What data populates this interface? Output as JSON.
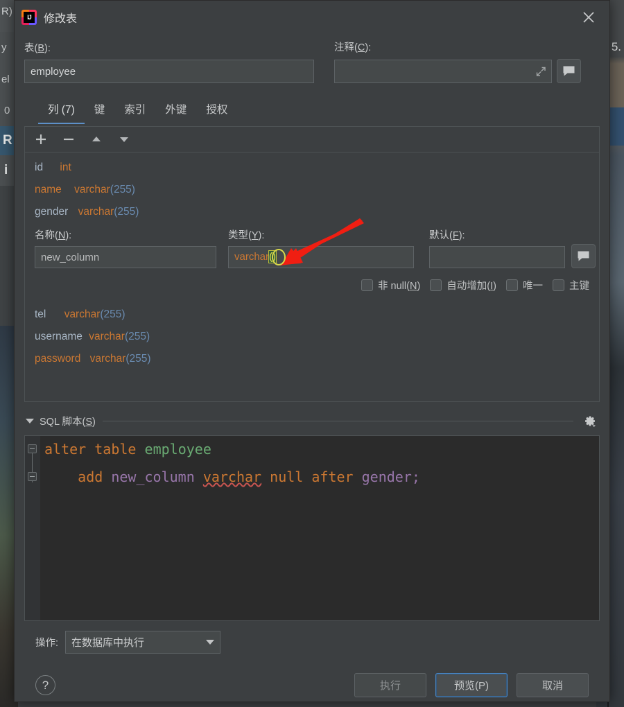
{
  "window": {
    "title": "修改表",
    "app_icon": "intellij-idea-logo",
    "close_icon": "close-icon"
  },
  "table_field": {
    "label": "表(B):",
    "label_plain": "表(",
    "mnemonic": "B",
    "label_suffix": "):",
    "value": "employee",
    "placeholder": ""
  },
  "comment_field": {
    "label_plain": "注释(",
    "mnemonic": "C",
    "label_suffix": "):",
    "value": "",
    "placeholder": "",
    "expand_icon": "expand-icon",
    "bubble_icon": "comment-bubble-icon"
  },
  "tabs": [
    {
      "label": "列 (7)",
      "active": true
    },
    {
      "label": "键",
      "active": false
    },
    {
      "label": "索引",
      "active": false
    },
    {
      "label": "外键",
      "active": false
    },
    {
      "label": "授权",
      "active": false
    }
  ],
  "columns_toolbar": [
    {
      "name": "add-column-button",
      "icon": "plus-icon"
    },
    {
      "name": "remove-column-button",
      "icon": "minus-icon"
    },
    {
      "name": "move-up-button",
      "icon": "arrow-up-icon"
    },
    {
      "name": "move-down-button",
      "icon": "arrow-down-icon"
    }
  ],
  "columns_before": [
    {
      "name": "id",
      "highlight": false,
      "type": "int",
      "length": ""
    },
    {
      "name": "name",
      "highlight": true,
      "type": "varchar",
      "length": "(255)"
    },
    {
      "name": "gender",
      "highlight": false,
      "type": "varchar",
      "length": "(255)"
    }
  ],
  "columns_after": [
    {
      "name": "tel",
      "highlight": false,
      "type": "varchar",
      "length": "(255)"
    },
    {
      "name": "username",
      "highlight": false,
      "type": "varchar",
      "length": "(255)"
    },
    {
      "name": "password",
      "highlight": true,
      "type": "varchar",
      "length": "(255)"
    }
  ],
  "inline_editor": {
    "name": {
      "label_plain": "名称(",
      "mnemonic": "N",
      "label_suffix": "):",
      "value": "new_column"
    },
    "type": {
      "label_plain": "类型(",
      "mnemonic": "Y",
      "label_suffix": "):",
      "value_text": "varchar",
      "value_parens": "()"
    },
    "default": {
      "label_plain": "默认(",
      "mnemonic": "F",
      "label_suffix": "):",
      "value": "",
      "bubble_icon": "comment-bubble-icon"
    },
    "checkboxes": [
      {
        "label_plain": "非 null(",
        "mnemonic": "N",
        "label_suffix": ")",
        "checked": false,
        "name": "not-null"
      },
      {
        "label_plain": "自动增加(",
        "mnemonic": "I",
        "label_suffix": ")",
        "checked": false,
        "name": "auto-increment"
      },
      {
        "label_plain": "唯一",
        "mnemonic": "",
        "label_suffix": "",
        "checked": false,
        "name": "unique"
      },
      {
        "label_plain": "主键",
        "mnemonic": "",
        "label_suffix": "",
        "checked": false,
        "name": "primary-key"
      }
    ]
  },
  "sql_section": {
    "title_plain": "SQL 脚本(",
    "mnemonic": "S",
    "title_suffix": ")",
    "gear_icon": "gear-icon",
    "code": {
      "line1": {
        "kw1": "alter",
        "kw2": "table",
        "table": "employee"
      },
      "line2": {
        "kw_add": "add",
        "ident_col": "new_column",
        "kw_type": "varchar",
        "kw_null": "null",
        "kw_after": "after",
        "ident_ref": "gender",
        "semicolon": ";"
      }
    }
  },
  "action_row": {
    "label": "操作:",
    "selected": "在数据库中执行",
    "caret_icon": "chevron-down-icon"
  },
  "footer": {
    "help_label": "?",
    "buttons": [
      {
        "label": "执行",
        "state": "disabled",
        "name": "execute-button"
      },
      {
        "label": "预览(P)",
        "state": "focused",
        "name": "preview-button"
      },
      {
        "label": "取消",
        "state": "normal",
        "name": "cancel-button"
      }
    ]
  },
  "background": {
    "left_fragments": [
      "R)",
      "y",
      "el",
      "0",
      "R",
      "i"
    ],
    "right_fragment": "5."
  },
  "colors": {
    "dialog_bg": "#3c3f41",
    "input_bg": "#45494a",
    "editor_bg": "#2b2b2b",
    "accent_tab": "#5d90c8",
    "keyword": "#cc7832",
    "identifier": "#9876aa",
    "table_name": "#6aab73",
    "length": "#6a8bb0",
    "annotation_arrow": "#f01e12",
    "paren_highlight": "#e8e84a"
  }
}
